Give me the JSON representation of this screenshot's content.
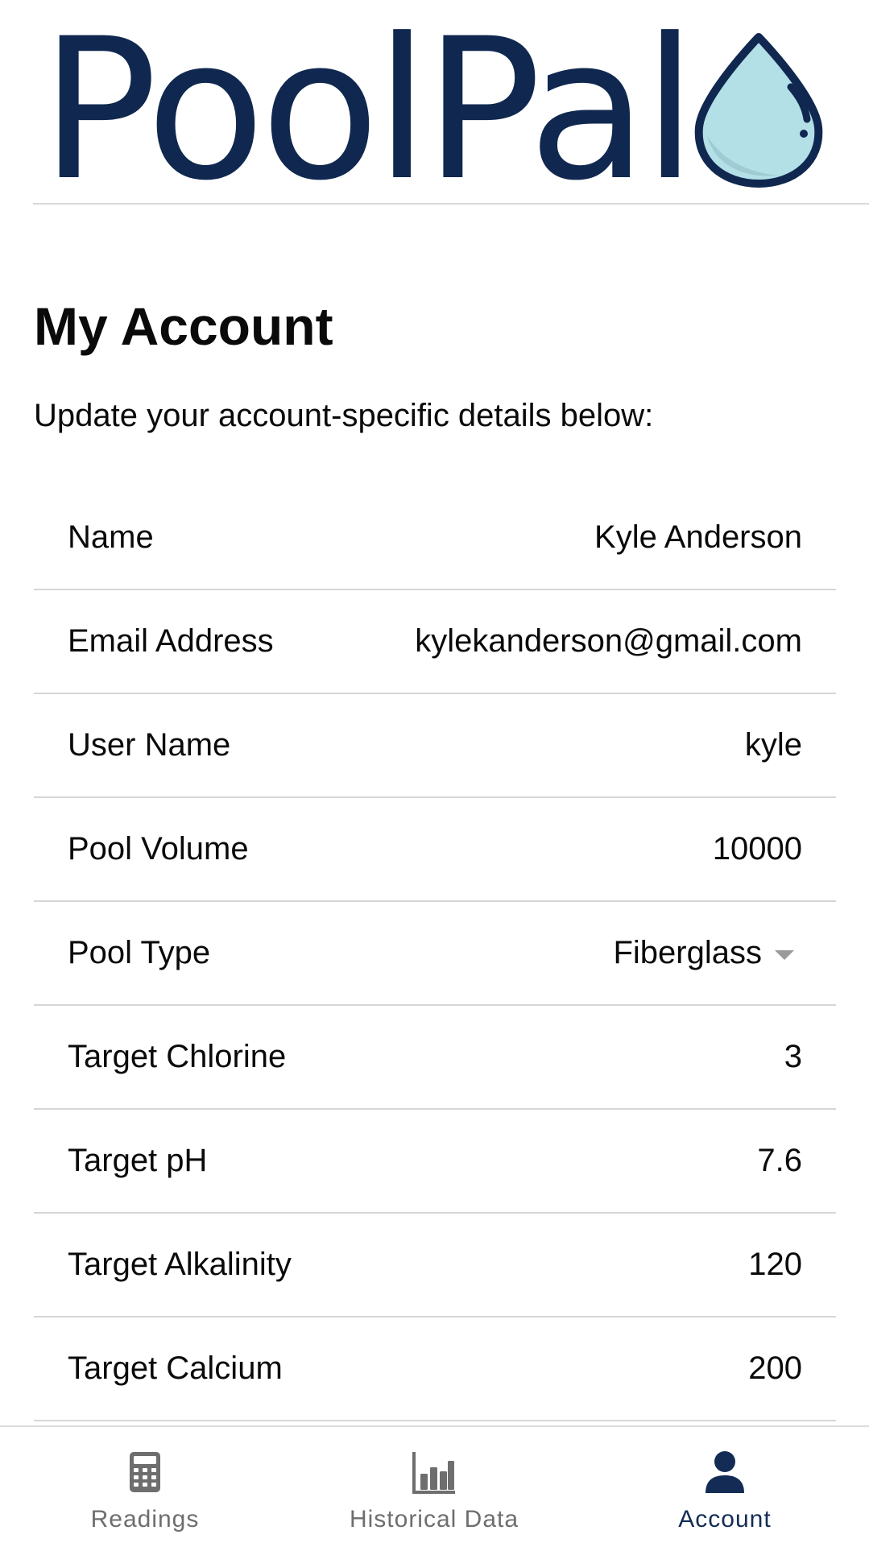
{
  "header": {
    "logo_text": "PoolPal",
    "colors": {
      "brand_navy": "#102850",
      "drop_fill": "#b3dfe6",
      "drop_shadow": "#8fb9c4"
    },
    "logo_icon": "water-drop-icon"
  },
  "page": {
    "title": "My Account",
    "subtitle": "Update your account-specific details below:"
  },
  "settings": [
    {
      "label": "Name",
      "value": "Kyle Anderson"
    },
    {
      "label": "Email Address",
      "value": "kylekanderson@gmail.com"
    },
    {
      "label": "User Name",
      "value": "kyle"
    },
    {
      "label": "Pool Volume",
      "value": "10000"
    },
    {
      "label": "Pool Type",
      "value": "Fiberglass"
    },
    {
      "label": "Target Chlorine",
      "value": "3"
    },
    {
      "label": "Target pH",
      "value": "7.6"
    },
    {
      "label": "Target Alkalinity",
      "value": "120"
    },
    {
      "label": "Target Calcium",
      "value": "200"
    }
  ],
  "tabs": [
    {
      "label": "Readings",
      "icon": "calculator-icon",
      "active": false
    },
    {
      "label": "Historical Data",
      "icon": "bar-chart-icon",
      "active": false
    },
    {
      "label": "Account",
      "icon": "person-icon",
      "active": true
    }
  ],
  "colors": {
    "tab_inactive": "#6e6e6e",
    "tab_active": "#142c55"
  }
}
